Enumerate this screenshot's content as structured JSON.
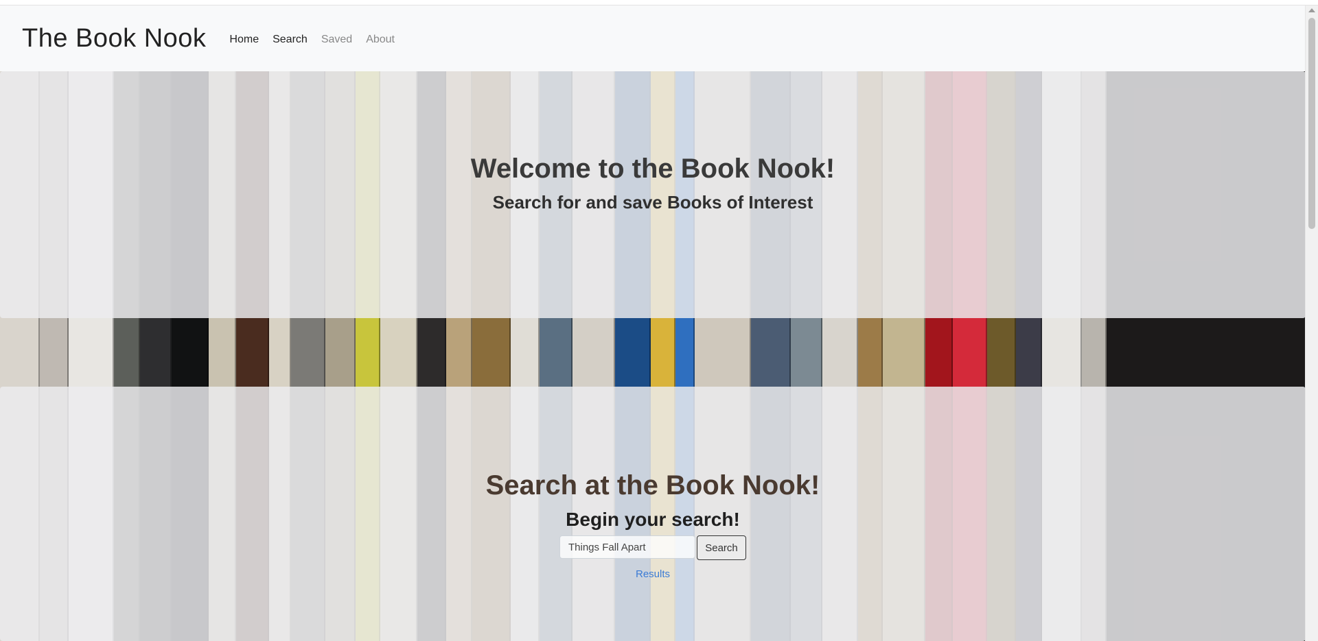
{
  "navbar": {
    "brand": "The Book Nook",
    "links": [
      {
        "label": "Home",
        "active": true
      },
      {
        "label": "Search",
        "active": true
      },
      {
        "label": "Saved",
        "active": false
      },
      {
        "label": "About",
        "active": false
      }
    ]
  },
  "hero": {
    "title": "Welcome to the Book Nook!",
    "subtitle": "Search for and save Books of Interest"
  },
  "search": {
    "title": "Search at the Book Nook!",
    "subtitle": "Begin your search!",
    "input_value": "Things Fall Apart",
    "button_label": "Search",
    "results_link": "Results"
  },
  "colors": {
    "brand_text": "#222222",
    "navbar_bg": "#f8f9fa",
    "link_accent": "#3a7bd5"
  }
}
